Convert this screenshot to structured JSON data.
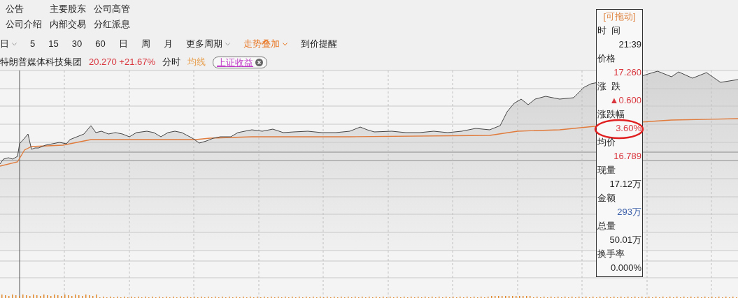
{
  "links": [
    [
      "公告",
      "主要股东",
      "公司高管"
    ],
    [
      "公司介绍",
      "内部交易",
      "分红派息"
    ]
  ],
  "periods": [
    {
      "label": "日",
      "kind": "dropdown",
      "selected": false
    },
    {
      "label": "5",
      "kind": "plain",
      "selected": false
    },
    {
      "label": "15",
      "kind": "plain",
      "selected": false
    },
    {
      "label": "30",
      "kind": "plain",
      "selected": false
    },
    {
      "label": "60",
      "kind": "plain",
      "selected": false
    },
    {
      "label": "日",
      "kind": "plain",
      "selected": false
    },
    {
      "label": "周",
      "kind": "plain",
      "selected": false
    },
    {
      "label": "月",
      "kind": "plain",
      "selected": false
    },
    {
      "label": "更多周期",
      "kind": "dropdown",
      "selected": false
    },
    {
      "label": "走势叠加",
      "kind": "dropdown",
      "selected": true
    },
    {
      "label": "到价提醒",
      "kind": "plain",
      "selected": false
    }
  ],
  "info": {
    "name": "特朗普媒体科技集团",
    "quote": "20.270 +21.67%",
    "mode": "分时",
    "ma": "均线",
    "overlay": "上证收益"
  },
  "tooltip": {
    "header": "[可拖动]",
    "items": [
      {
        "label": "时  间",
        "value": "21:39",
        "color": "#222222",
        "highlighted": false
      },
      {
        "label": "价格",
        "value": "17.260",
        "color": "#d9363e",
        "highlighted": false
      },
      {
        "label": "涨  跌",
        "value": "▲0.600",
        "color": "#d9363e",
        "highlighted": false
      },
      {
        "label": "涨跌幅",
        "value": "3.60%",
        "color": "#d9363e",
        "highlighted": true
      },
      {
        "label": "均价",
        "value": "16.789",
        "color": "#d9363e",
        "highlighted": false
      },
      {
        "label": "现量",
        "value": "17.12万",
        "color": "#222222",
        "highlighted": false
      },
      {
        "label": "金额",
        "value": "293万",
        "color": "#3a5ea8",
        "highlighted": false
      },
      {
        "label": "总量",
        "value": "50.01万",
        "color": "#222222",
        "highlighted": false
      },
      {
        "label": "换手率",
        "value": "0.000%",
        "color": "#222222",
        "highlighted": false
      }
    ]
  }
}
